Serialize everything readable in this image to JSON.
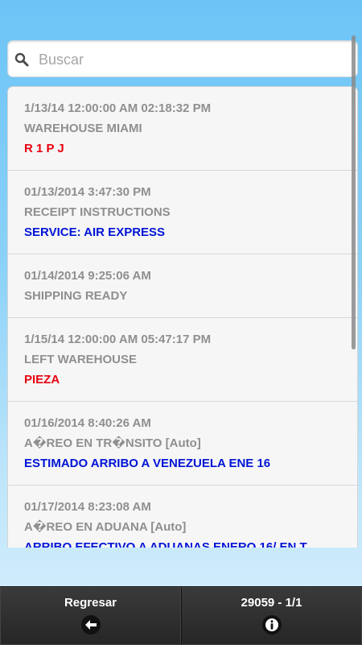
{
  "search": {
    "placeholder": "Buscar",
    "value": "",
    "icon": "search-icon"
  },
  "events": [
    {
      "date": "1/13/14 12:00:00 AM 02:18:32 PM",
      "status": "WAREHOUSE MIAMI",
      "detail": "R 1 P J",
      "detail_color": "red"
    },
    {
      "date": "01/13/2014 3:47:30 PM",
      "status": "RECEIPT INSTRUCTIONS",
      "detail": "SERVICE: AIR EXPRESS",
      "detail_color": "blue"
    },
    {
      "date": "01/14/2014 9:25:06 AM",
      "status": "SHIPPING READY",
      "detail": null,
      "detail_color": null
    },
    {
      "date": "1/15/14 12:00:00 AM 05:47:17 PM",
      "status": "LEFT WAREHOUSE",
      "detail": "PIEZA",
      "detail_color": "red"
    },
    {
      "date": "01/16/2014 8:40:26 AM",
      "status": "A�REO EN TR�NSITO [Auto]",
      "detail": "ESTIMADO ARRIBO A VENEZUELA ENE 16",
      "detail_color": "blue"
    },
    {
      "date": "01/17/2014 8:23:08 AM",
      "status": "A�REO EN ADUANA [Auto]",
      "detail": "ARRIBO EFECTIVO A ADUANAS ENERO 16/ EN T",
      "detail_color": "blue"
    }
  ],
  "footer": {
    "back_label": "Regresar",
    "back_icon": "arrow-left-icon",
    "info_label": "29059 - 1/1",
    "info_icon": "info-icon"
  },
  "colors": {
    "red_text": "#e8000f",
    "blue_text": "#0014d6",
    "gray_text": "#8f8f8f"
  }
}
